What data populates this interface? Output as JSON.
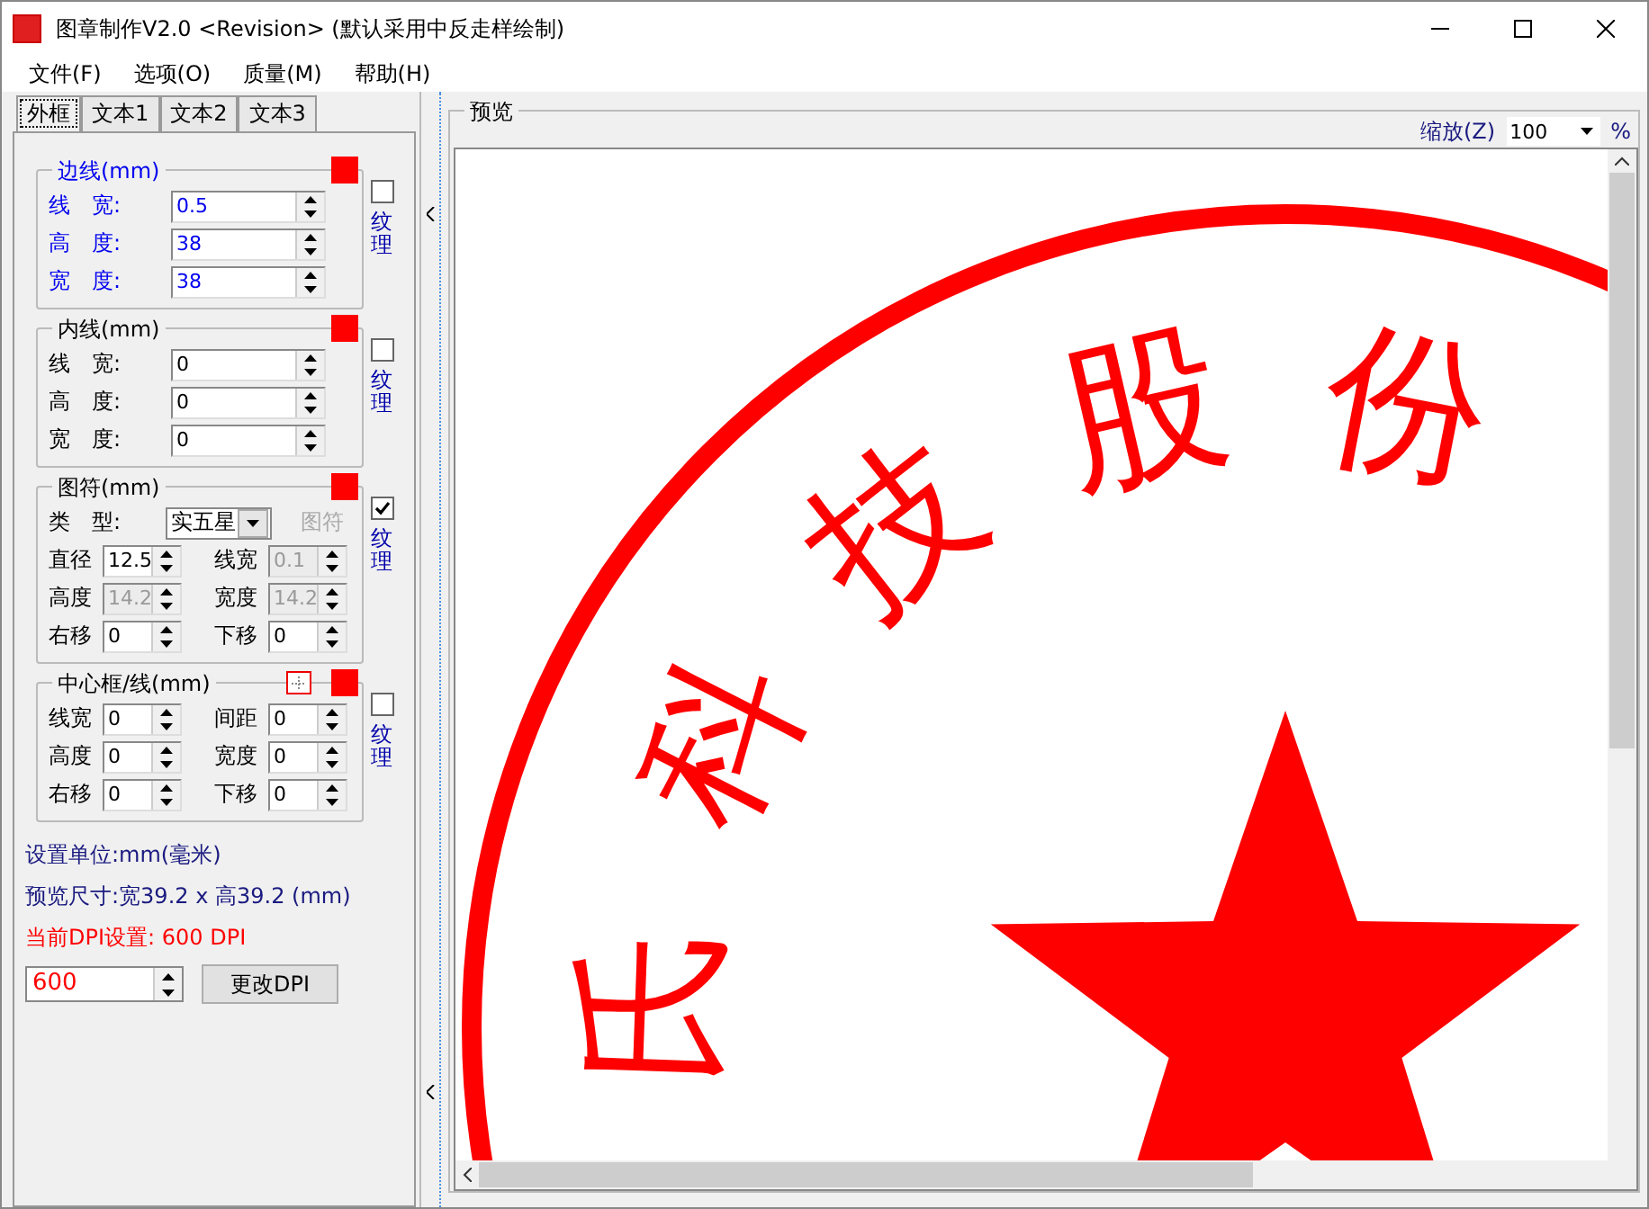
{
  "window": {
    "title": "图章制作V2.0 <Revision> (默认采用中反走样绘制)"
  },
  "menu": [
    "文件(F)",
    "选项(O)",
    "质量(M)",
    "帮助(H)"
  ],
  "tabs": [
    {
      "label": "外框",
      "selected": true
    },
    {
      "label": "文本1",
      "selected": false
    },
    {
      "label": "文本2",
      "selected": false
    },
    {
      "label": "文本3",
      "selected": false
    }
  ],
  "groups": [
    {
      "kind": "single",
      "title": "边线(mm)",
      "emphasized": true,
      "color": "#ff0000",
      "texture": {
        "label": "纹理",
        "checked": false
      },
      "fields": [
        {
          "label": "线　宽:",
          "value": "0.5",
          "disabled": false
        },
        {
          "label": "高　度:",
          "value": "38",
          "disabled": false
        },
        {
          "label": "宽　度:",
          "value": "38",
          "disabled": false
        }
      ]
    },
    {
      "kind": "single",
      "title": "内线(mm)",
      "emphasized": false,
      "color": "#ff0000",
      "texture": {
        "label": "纹理",
        "checked": false
      },
      "fields": [
        {
          "label": "线　宽:",
          "value": "0",
          "disabled": false
        },
        {
          "label": "高　度:",
          "value": "0",
          "disabled": false
        },
        {
          "label": "宽　度:",
          "value": "0",
          "disabled": false
        }
      ]
    },
    {
      "kind": "symbol",
      "title": "图符(mm)",
      "emphasized": false,
      "color": "#ff0000",
      "texture": {
        "label": "纹理",
        "checked": true
      },
      "type_label": "类　型:",
      "type_value": "实五星",
      "symbol_button": {
        "label": "图符",
        "disabled": true
      },
      "fields": [
        {
          "label": "直径",
          "value": "12.5",
          "disabled": false
        },
        {
          "label": "线宽",
          "value": "0.1",
          "disabled": true
        },
        {
          "label": "高度",
          "value": "14.2",
          "disabled": true
        },
        {
          "label": "宽度",
          "value": "14.2",
          "disabled": true
        },
        {
          "label": "右移",
          "value": "0",
          "disabled": false
        },
        {
          "label": "下移",
          "value": "0",
          "disabled": false
        }
      ]
    },
    {
      "kind": "center",
      "title": "中心框/线(mm)",
      "emphasized": false,
      "color": "#ff0000",
      "texture": {
        "label": "纹理",
        "checked": false
      },
      "fields": [
        {
          "label": "线宽",
          "value": "0",
          "disabled": false
        },
        {
          "label": "间距",
          "value": "0",
          "disabled": false
        },
        {
          "label": "高度",
          "value": "0",
          "disabled": false
        },
        {
          "label": "宽度",
          "value": "0",
          "disabled": false
        },
        {
          "label": "右移",
          "value": "0",
          "disabled": false
        },
        {
          "label": "下移",
          "value": "0",
          "disabled": false
        }
      ]
    }
  ],
  "info": [
    "设置单位:mm(毫米)",
    "预览尺寸:宽39.2 x 高39.2 (mm)"
  ],
  "dpi": {
    "label": "当前DPI设置: 600 DPI",
    "value": "600",
    "button": "更改DPI"
  },
  "preview": {
    "title": "预览",
    "zoom_label": "缩放(Z)",
    "zoom_value": "100",
    "zoom_unit": "%",
    "stamp_text": [
      "氏",
      "科",
      "技",
      "股",
      "份"
    ]
  }
}
